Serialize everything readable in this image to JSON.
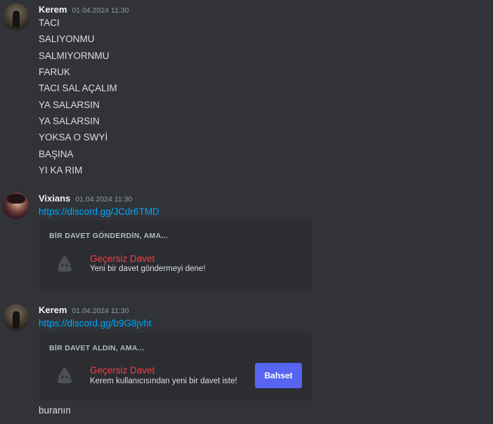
{
  "messages": [
    {
      "author": "Kerem",
      "timestamp": "01.04.2024 11:30",
      "lines": [
        "TACI",
        "SALIYONMU",
        "SALMIYORNMU",
        "FARUK",
        "TACI SAL AÇALIM",
        "YA SALARSIN",
        "YA SALARSIN",
        "YOKSA O SWYİ",
        "BAŞINA",
        "YI KA RIM"
      ]
    },
    {
      "author": "Vixians",
      "timestamp": "01.04.2024 11:30",
      "link": "https://discord.gg/JCdr6TMD",
      "invite": {
        "title": "BİR DAVET GÖNDERDİN, AMA...",
        "name": "Geçersiz Davet",
        "subtitle": "Yeni bir davet göndermeyi dene!"
      }
    },
    {
      "author": "Kerem",
      "timestamp": "01.04.2024 11:30",
      "link": "https://discord.gg/b9G8jvht",
      "invite": {
        "title": "BİR DAVET ALDIN, AMA...",
        "name": "Geçersiz Davet",
        "subtitle": "Kerem kullanıcısından yeni bir davet iste!",
        "button": "Bahset"
      },
      "followup": "buranın"
    }
  ],
  "icons": {
    "invalid_invite": "poop-icon"
  },
  "colors": {
    "background": "#313338",
    "embed_background": "#2b2d31",
    "link": "#00a8fc",
    "invalid": "#f23f43",
    "button": "#5865f2"
  }
}
